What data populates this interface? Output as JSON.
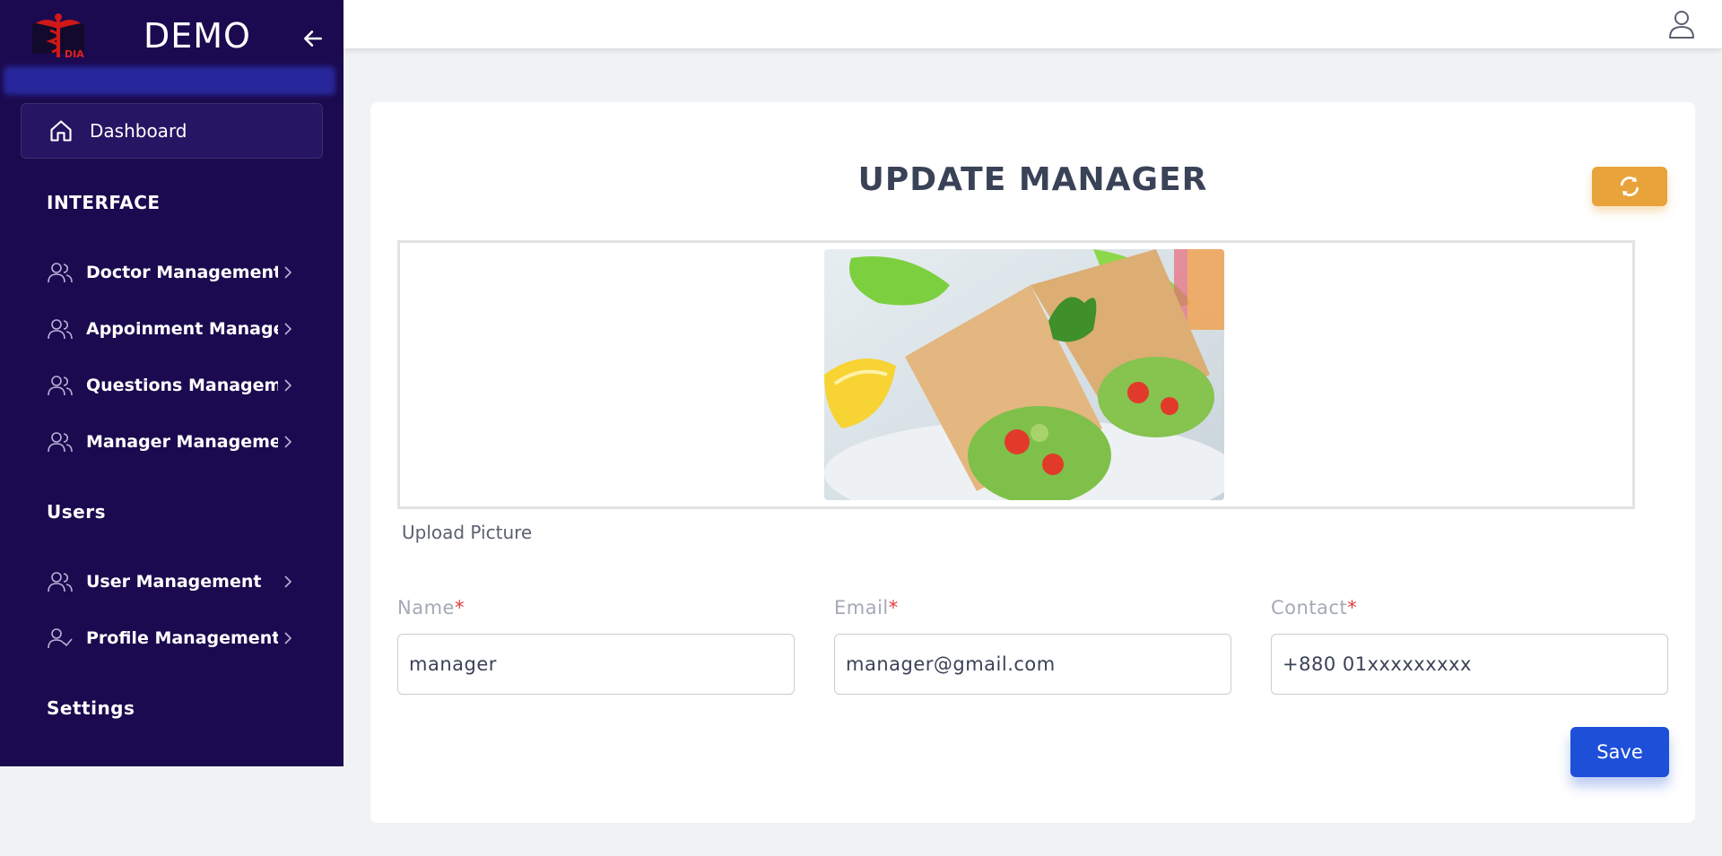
{
  "brand": {
    "name": "DEMO",
    "logo_text": "DIA"
  },
  "sidebar": {
    "dashboard_label": "Dashboard",
    "sections": [
      {
        "title": "INTERFACE"
      },
      {
        "title": "Users"
      },
      {
        "title": "Settings"
      }
    ],
    "items": [
      {
        "label": "Doctor Management",
        "icon": "users-icon"
      },
      {
        "label": "Appoinment Managem",
        "icon": "users-icon"
      },
      {
        "label": "Questions Managemer",
        "icon": "users-icon"
      },
      {
        "label": "Manager Management",
        "icon": "users-icon"
      },
      {
        "label": "User Management",
        "icon": "users-icon"
      },
      {
        "label": "Profile Management",
        "icon": "user-check-icon"
      }
    ]
  },
  "main": {
    "title": "UPDATE MANAGER",
    "upload_label": "Upload Picture",
    "fields": {
      "name": {
        "label": "Name",
        "required_mark": "*",
        "value": "manager"
      },
      "email": {
        "label": "Email",
        "required_mark": "*",
        "value": "manager@gmail.com"
      },
      "contact": {
        "label": "Contact",
        "required_mark": "*",
        "value": "+880 01xxxxxxxxx"
      }
    },
    "save_label": "Save"
  },
  "colors": {
    "sidebar_bg": "#1b0a4f",
    "refresh_button": "#e8a33a",
    "save_button": "#1d4fd8",
    "required": "#e03c3c"
  }
}
